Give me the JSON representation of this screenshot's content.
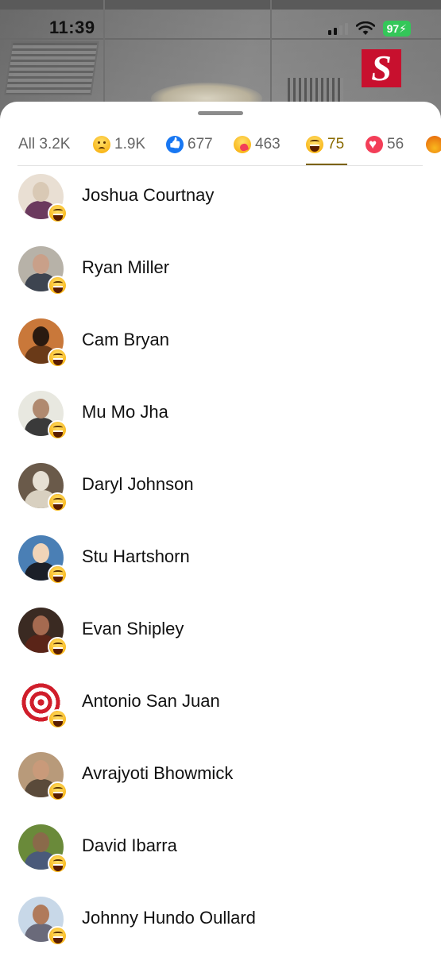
{
  "status_bar": {
    "time": "11:39",
    "battery": "97"
  },
  "brand_logo_letter": "S",
  "tabs": [
    {
      "label": "All 3.2K",
      "emoji": ""
    },
    {
      "label": "1.9K",
      "emoji": "sad"
    },
    {
      "label": "677",
      "emoji": "like"
    },
    {
      "label": "463",
      "emoji": "care"
    },
    {
      "label": "75",
      "emoji": "haha",
      "active": true
    },
    {
      "label": "56",
      "emoji": "love"
    },
    {
      "label": "",
      "emoji": "angry"
    }
  ],
  "people": [
    {
      "name": "Joshua Courtnay",
      "reaction": "haha"
    },
    {
      "name": "Ryan Miller",
      "reaction": "haha"
    },
    {
      "name": "Cam Bryan",
      "reaction": "haha"
    },
    {
      "name": "Mu Mo Jha",
      "reaction": "haha"
    },
    {
      "name": "Daryl Johnson",
      "reaction": "haha"
    },
    {
      "name": "Stu Hartshorn",
      "reaction": "haha"
    },
    {
      "name": "Evan Shipley",
      "reaction": "haha"
    },
    {
      "name": "Antonio San Juan",
      "reaction": "haha"
    },
    {
      "name": "Avrajyoti Bhowmick",
      "reaction": "haha"
    },
    {
      "name": "David Ibarra",
      "reaction": "haha"
    },
    {
      "name": "Johnny Hundo Oullard",
      "reaction": "haha"
    }
  ],
  "colors": {
    "accent": "#8a6b00",
    "brand_red": "#c8102e",
    "like_blue": "#1877f2",
    "love_red": "#f33e58"
  }
}
